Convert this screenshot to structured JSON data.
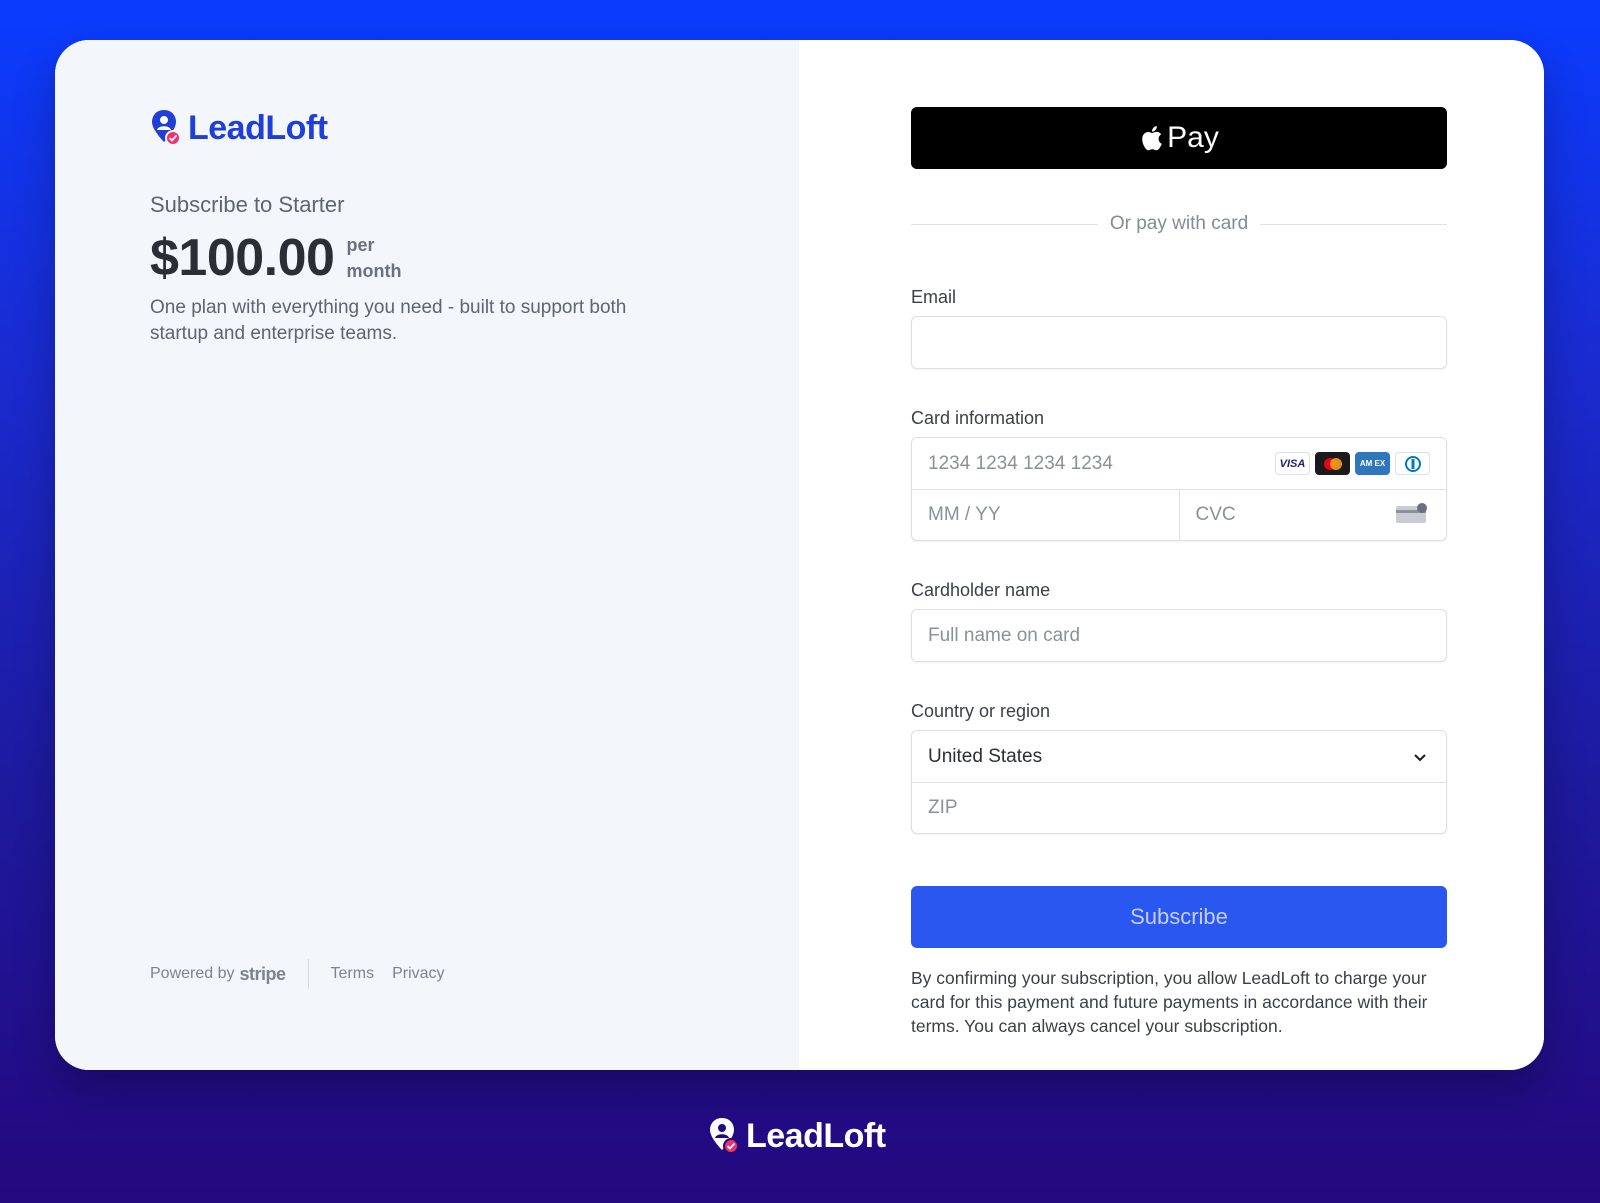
{
  "brand": {
    "name": "LeadLoft",
    "accent": "#1f3fd6",
    "badge_color": "#f0306f"
  },
  "plan": {
    "subtitle": "Subscribe to Starter",
    "price": "$100.00",
    "period_line1": "per",
    "period_line2": "month",
    "description": "One plan with everything you need - built to support both startup and enterprise teams."
  },
  "footer": {
    "powered_by": "Powered by",
    "stripe": "stripe",
    "terms": "Terms",
    "privacy": "Privacy"
  },
  "payment": {
    "apple_pay_label": "Pay",
    "divider_text": "Or pay with card",
    "email_label": "Email",
    "email_value": "",
    "card_label": "Card information",
    "card_number_placeholder": "1234 1234 1234 1234",
    "expiry_placeholder": "MM / YY",
    "cvc_placeholder": "CVC",
    "card_brands": [
      "VISA",
      "mastercard",
      "amex",
      "diners"
    ],
    "cardholder_label": "Cardholder name",
    "cardholder_placeholder": "Full name on card",
    "country_label": "Country or region",
    "country_value": "United States",
    "zip_placeholder": "ZIP",
    "subscribe_label": "Subscribe",
    "subscribe_color": "#2a57f0",
    "legal_text": "By confirming your subscription, you allow LeadLoft to charge your card for this payment and future payments in accordance with their terms. You can always cancel your subscription."
  }
}
